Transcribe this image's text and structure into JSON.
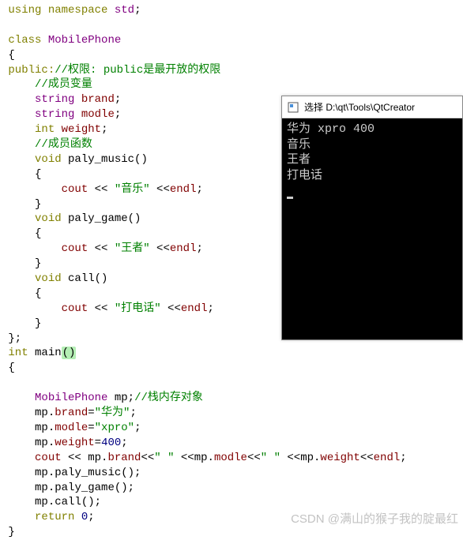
{
  "code": {
    "using": "using",
    "namespace": "namespace",
    "std": "std",
    "class_kw": "class",
    "class_name": "MobilePhone",
    "public_kw": "public:",
    "cmt_access": "//权限: public是最开放的权限",
    "cmt_members": "//成员变量",
    "string_t": "string",
    "brand": "brand",
    "modle": "modle",
    "int_t": "int",
    "weight": "weight",
    "cmt_funcs": "//成员函数",
    "void_t": "void",
    "fn_music": "paly_music",
    "fn_game": "paly_game",
    "fn_call": "call",
    "cout": "cout",
    "endl": "endl",
    "str_music": "\"音乐\"",
    "str_game": "\"王者\"",
    "str_call": "\"打电话\"",
    "main": "main",
    "mp": "mp",
    "cmt_stack": "//栈内存对象",
    "assign_brand": "\"华为\"",
    "assign_modle": "\"xpro\"",
    "assign_weight": "400",
    "return_kw": "return",
    "zero": "0",
    "space_str": "\" \""
  },
  "console": {
    "title": "选择 D:\\qt\\Tools\\QtCreator",
    "line1": "华为 xpro 400",
    "line2": "音乐",
    "line3": "王者",
    "line4": "打电话"
  },
  "watermark": "CSDN @满山的猴子我的腚最红"
}
